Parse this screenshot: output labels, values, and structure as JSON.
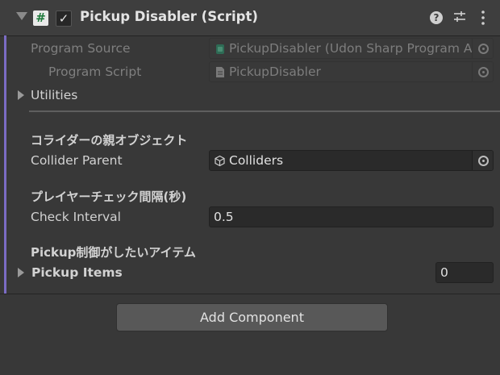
{
  "header": {
    "title": "Pickup Disabler (Script)",
    "enabled_check": "✓",
    "script_icon_glyph": "#",
    "help_glyph": "?"
  },
  "properties": {
    "program_source": {
      "label": "Program Source",
      "value": "PickupDisabler (Udon Sharp Program Asset)"
    },
    "program_script": {
      "label": "Program Script",
      "value": "PickupDisabler"
    },
    "utilities_label": "Utilities",
    "collider_section_header": "コライダーの親オブジェクト",
    "collider_parent": {
      "label": "Collider Parent",
      "value": "Colliders"
    },
    "interval_section_header": "プレイヤーチェック間隔(秒)",
    "check_interval": {
      "label": "Check Interval",
      "value": "0.5"
    },
    "pickup_section_header": "Pickup制御がしたいアイテム",
    "pickup_items": {
      "label": "Pickup Items",
      "count": "0"
    }
  },
  "footer": {
    "add_component_label": "Add Component"
  },
  "icons": {
    "header": [
      "foldout-arrow-icon",
      "csharp-script-icon",
      "help-icon",
      "preset-icon",
      "kebab-menu-icon"
    ],
    "fields": [
      "udon-asset-icon",
      "script-file-icon",
      "gameobject-cube-icon",
      "object-picker-icon"
    ]
  },
  "colors": {
    "accent_bar": "#7b6cc4",
    "script_icon_green": "#1f7a3c",
    "panel_background": "#383838"
  }
}
